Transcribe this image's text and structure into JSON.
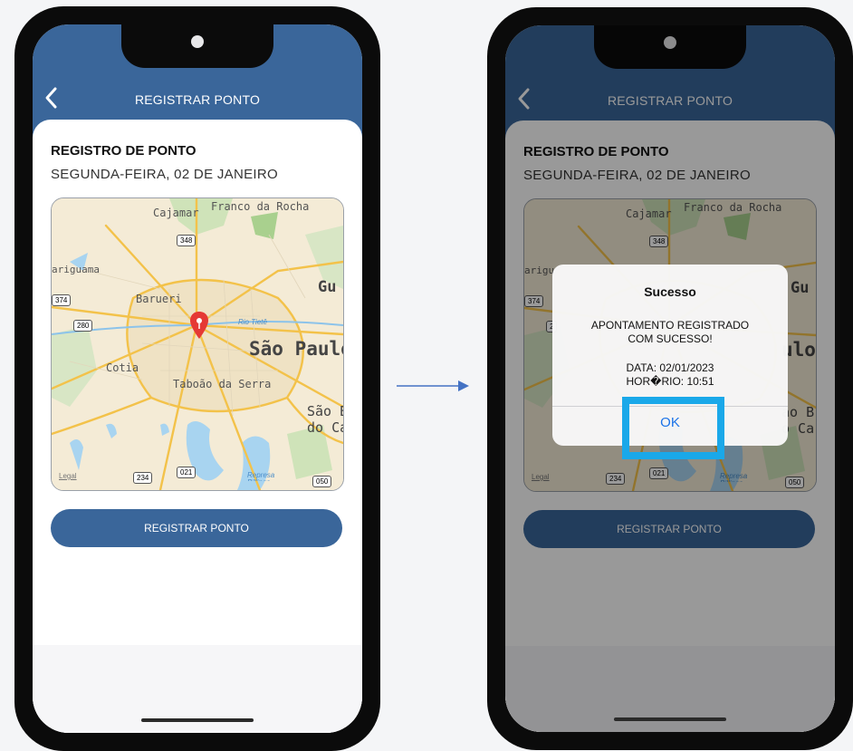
{
  "left_phone": {
    "header_title": "REGISTRAR PONTO",
    "card_title": "REGISTRO DE PONTO",
    "card_date": "SEGUNDA-FEIRA, 02 DE JANEIRO",
    "register_button_label": "REGISTRAR PONTO",
    "map_labels": [
      "Cajamar",
      "Franco da Rocha",
      "ariguama",
      "Barueri",
      "São Paulo",
      "Cotia",
      "Taboão da Serra",
      "São B",
      "do Ca",
      "Gu",
      "Rio Tietê",
      "Legal",
      "Represa Billings"
    ],
    "map_road_numbers": [
      "348",
      "374",
      "280",
      "234",
      "021",
      "050"
    ]
  },
  "right_phone": {
    "header_title": "REGISTRAR PONTO",
    "card_title": "REGISTRO DE PONTO",
    "card_date": "SEGUNDA-FEIRA, 02 DE JANEIRO",
    "register_button_label": "REGISTRAR PONTO",
    "map_labels": [
      "Cajamar",
      "Franco da Rocha",
      "arigu",
      "Gu",
      "ulo",
      "ão B",
      "o Ca",
      "Legal",
      "Represa Billings"
    ],
    "map_road_numbers": [
      "348",
      "374",
      "2",
      "234",
      "021",
      "050"
    ],
    "dialog": {
      "title": "Sucesso",
      "message_line1": "APONTAMENTO REGISTRADO",
      "message_line2": "COM SUCESSO!",
      "date_line": "DATA: 02/01/2023",
      "time_line": "HOR�RIO: 10:51",
      "ok_label": "OK"
    }
  },
  "colors": {
    "header_blue": "#3a669a",
    "button_blue": "#3a669a",
    "highlight": "#1aa8e9",
    "arrow": "#4472c4",
    "map_pin": "#e53935"
  }
}
